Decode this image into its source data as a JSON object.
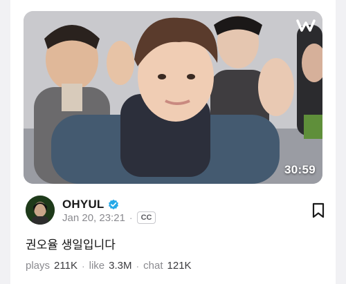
{
  "video": {
    "duration": "30:59",
    "brand_logo": "w-logo-icon",
    "thumbnail_icon": "group-selfie-thumbnail"
  },
  "creator": {
    "name": "OHYUL",
    "verified_icon": "verified-check-icon",
    "date": "Jan 20, 23:21",
    "separator": "·",
    "cc_label": "CC"
  },
  "bookmark_icon": "bookmark-icon",
  "post": {
    "title": "권오율 생일입니다"
  },
  "stats": {
    "plays_label": "plays",
    "plays_value": "211K",
    "like_label": "like",
    "like_value": "3.3M",
    "chat_label": "chat",
    "chat_value": "121K",
    "separator": "·"
  },
  "colors": {
    "verified": "#25a9e8",
    "text_primary": "#1a1a1a",
    "text_secondary": "#8a8a8f"
  }
}
